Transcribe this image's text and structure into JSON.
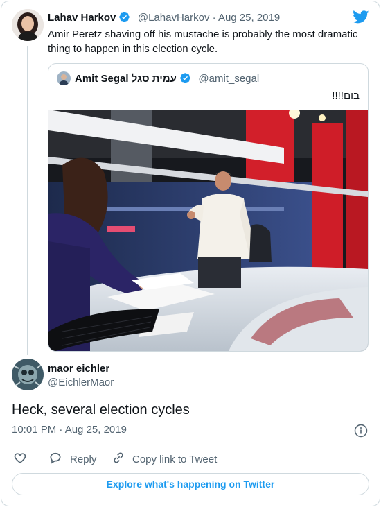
{
  "main_tweet": {
    "author_name": "Lahav Harkov",
    "handle_date": "@LahavHarkov · Aug 25, 2019",
    "text": "Amir Peretz shaving off his mustache is probably the most dramatic thing to happen in this election cycle."
  },
  "quoted_tweet": {
    "author_name": "Amit Segal עמית סגל",
    "handle": "@amit_segal",
    "text": "בום!!!!",
    "image_icon": "photo-tv-studio"
  },
  "reply_tweet": {
    "author_name": "maor eichler",
    "handle": "@EichlerMaor",
    "text": "Heck, several election cycles",
    "timestamp": "10:01 PM · Aug 25, 2019"
  },
  "actions": {
    "like_icon": "heart-icon",
    "reply_label": "Reply",
    "copy_label": "Copy link to Tweet"
  },
  "explore_label": "Explore what's happening on Twitter",
  "colors": {
    "accent": "#1d9bf0",
    "text": "#0f1419",
    "muted": "#536471",
    "border": "#cfd9de"
  }
}
